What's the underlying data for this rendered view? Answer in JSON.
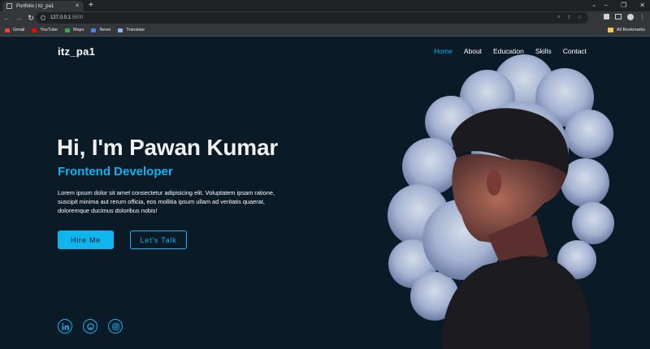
{
  "browser": {
    "tab_title": "Portfolio | itz_pa1",
    "url_host": "127.0.0.1",
    "url_port": ":5500",
    "bookmarks": [
      {
        "label": "Gmail",
        "color": "#ea4335"
      },
      {
        "label": "YouTube",
        "color": "#ff0000"
      },
      {
        "label": "Maps",
        "color": "#34a853"
      },
      {
        "label": "News",
        "color": "#4285f4"
      },
      {
        "label": "Translate",
        "color": "#8ab4f8"
      }
    ],
    "all_bookmarks": "All Bookmarks"
  },
  "site": {
    "logo": "itz_pa1",
    "nav": [
      "Home",
      "About",
      "Education",
      "Skills",
      "Contact"
    ],
    "active_nav": "Home",
    "title": "Hi, I'm Pawan Kumar",
    "subtitle": "Frontend Developer",
    "description": "Lorem ipsum dolor sit amet consectetur adipisicing elit. Voluptatem ipsam ratione, suscipit minima aut rerum officia, eos mollitia ipsum ullam ad veritatis quaerat, doloremque ducimus doloribus nobis!",
    "hire_button": "Hire Me",
    "talk_button": "Let's Talk",
    "socials": [
      "linkedin-icon",
      "github-icon",
      "instagram-icon"
    ],
    "accent_color": "#0fb5ee",
    "background_color": "#0b1a27"
  }
}
